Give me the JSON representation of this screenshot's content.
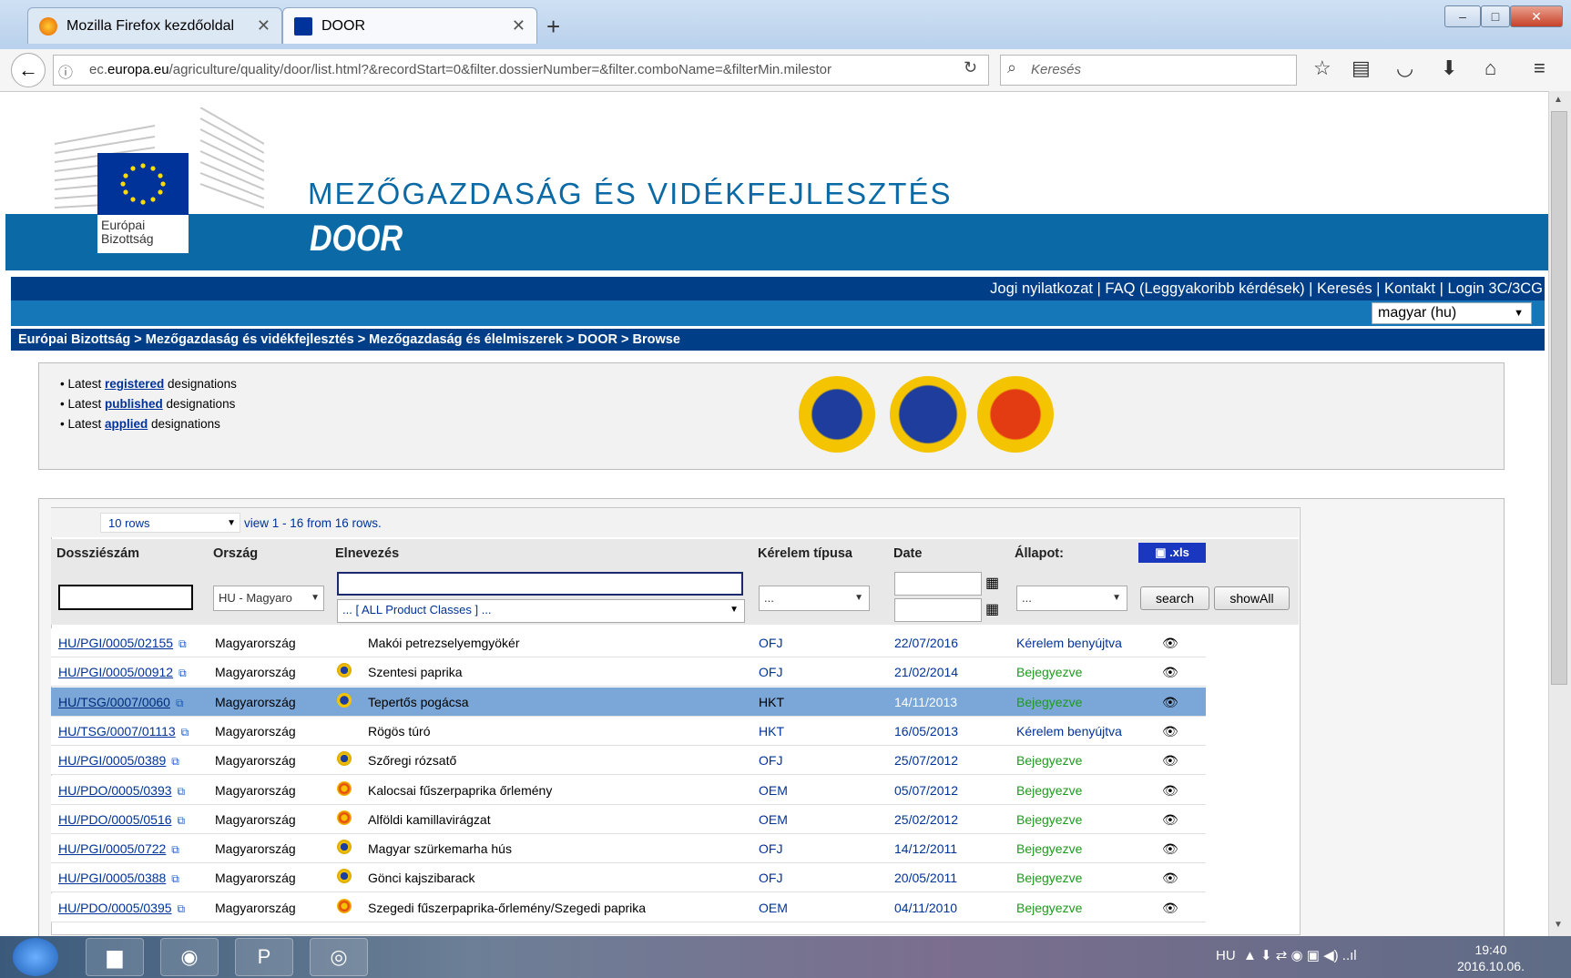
{
  "browser": {
    "tabs": [
      {
        "label": "Mozilla Firefox kezdőoldal"
      },
      {
        "label": "DOOR"
      }
    ],
    "url_prefix": "ec.",
    "url_domain": "europa.eu",
    "url_rest": "/agriculture/quality/door/list.html?&recordStart=0&filter.dossierNumber=&filter.comboName=&filterMin.milestor",
    "search_placeholder": "Keresés"
  },
  "header": {
    "eu_label": "Európai Bizottság",
    "department": "MEZŐGAZDASÁG ÉS VIDÉKFEJLESZTÉS",
    "app_name": "DOOR",
    "top_links": "Jogi nyilatkozat | FAQ (Leggyakoribb kérdések) | Keresés | Kontakt | Login 3C/3CG",
    "language": "magyar (hu)",
    "breadcrumb": "Európai Bizottság > Mezőgazdaság és vidékfejlesztés > Mezőgazdaság és élelmiszerek > DOOR > Browse"
  },
  "latest": [
    {
      "prefix": "Latest ",
      "link": "registered",
      "suffix": " designations"
    },
    {
      "prefix": "Latest ",
      "link": "published",
      "suffix": " designations"
    },
    {
      "prefix": "Latest ",
      "link": "applied",
      "suffix": " designations"
    }
  ],
  "table": {
    "rows_select": "10 rows",
    "view_info": "view 1 - 16 from 16 rows.",
    "columns": [
      "Dossziészám",
      "Ország",
      "Elnevezés",
      "Kérelem típusa",
      "Date",
      "Állapot:"
    ],
    "xls_label": ".xls",
    "filters": {
      "country": "HU - Magyaro",
      "product_classes": "... [ ALL Product Classes ] ...",
      "type": "...",
      "status": "...",
      "search_label": "search",
      "showall_label": "showAll"
    },
    "rows": [
      {
        "dossier": "HU/PGI/0005/02155",
        "country": "Magyarország",
        "name": "Makói petrezselyemgyökér",
        "type": "OFJ",
        "date": "22/07/2016",
        "status": "Kérelem benyújtva",
        "logo": "none"
      },
      {
        "dossier": "HU/PGI/0005/00912",
        "country": "Magyarország",
        "name": "Szentesi paprika",
        "type": "OFJ",
        "date": "21/02/2014",
        "status": "Bejegyezve",
        "logo": "pgi"
      },
      {
        "dossier": "HU/TSG/0007/0060",
        "country": "Magyarország",
        "name": "Tepertős pogácsa",
        "type": "HKT",
        "date": "14/11/2013",
        "status": "Bejegyezve",
        "logo": "tsg"
      },
      {
        "dossier": "HU/TSG/0007/01113",
        "country": "Magyarország",
        "name": "Rögös túró",
        "type": "HKT",
        "date": "16/05/2013",
        "status": "Kérelem benyújtva",
        "logo": "none"
      },
      {
        "dossier": "HU/PGI/0005/0389",
        "country": "Magyarország",
        "name": "Szőregi rózsatő",
        "type": "OFJ",
        "date": "25/07/2012",
        "status": "Bejegyezve",
        "logo": "pgi"
      },
      {
        "dossier": "HU/PDO/0005/0393",
        "country": "Magyarország",
        "name": "Kalocsai fűszerpaprika őrlemény",
        "type": "OEM",
        "date": "05/07/2012",
        "status": "Bejegyezve",
        "logo": "pdo"
      },
      {
        "dossier": "HU/PDO/0005/0516",
        "country": "Magyarország",
        "name": "Alföldi kamillavirágzat",
        "type": "OEM",
        "date": "25/02/2012",
        "status": "Bejegyezve",
        "logo": "pdo"
      },
      {
        "dossier": "HU/PGI/0005/0722",
        "country": "Magyarország",
        "name": "Magyar szürkemarha hús",
        "type": "OFJ",
        "date": "14/12/2011",
        "status": "Bejegyezve",
        "logo": "pgi"
      },
      {
        "dossier": "HU/PGI/0005/0388",
        "country": "Magyarország",
        "name": "Gönci kajszibarack",
        "type": "OFJ",
        "date": "20/05/2011",
        "status": "Bejegyezve",
        "logo": "pgi"
      },
      {
        "dossier": "HU/PDO/0005/0395",
        "country": "Magyarország",
        "name": "Szegedi fűszerpaprika-őrlemény/Szegedi paprika",
        "type": "OEM",
        "date": "04/11/2010",
        "status": "Bejegyezve",
        "logo": "pdo"
      }
    ],
    "selected_row": 2
  },
  "taskbar": {
    "lang": "HU",
    "time": "19:40",
    "date": "2016.10.06."
  }
}
